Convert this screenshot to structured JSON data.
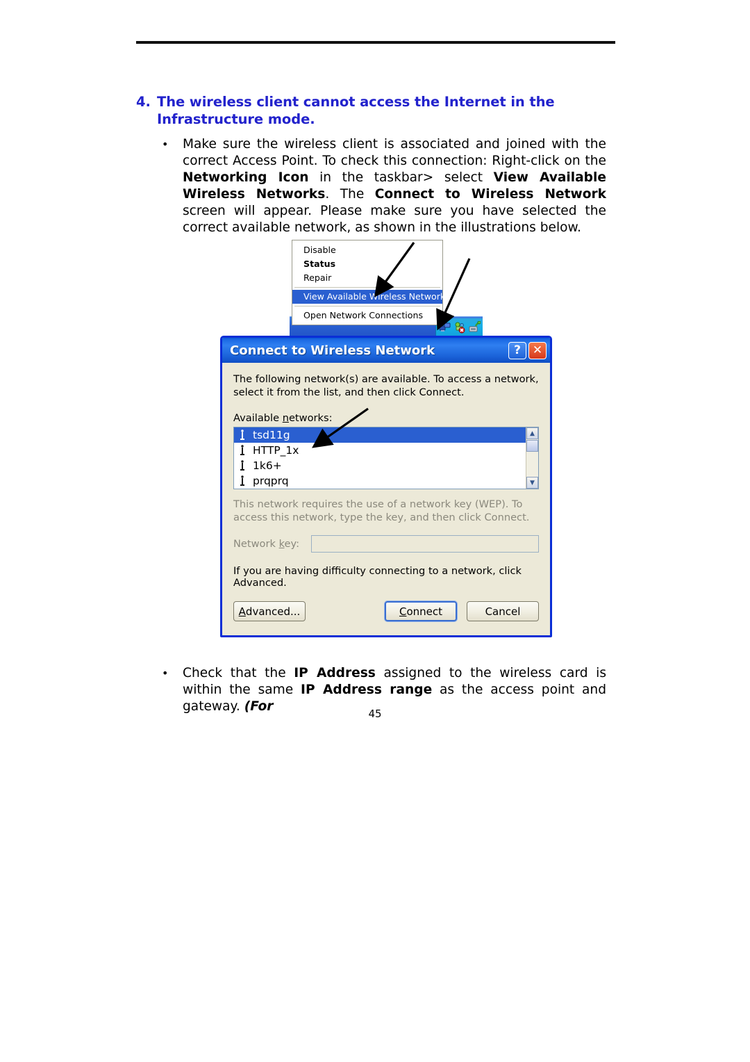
{
  "document": {
    "page_number": "45",
    "heading": {
      "number": "4.",
      "text": "The wireless client cannot access the Internet in the Infrastructure mode.",
      "color": "#2222CC"
    },
    "bullets": [
      {
        "marker": "•",
        "segments": [
          {
            "text": "Make sure the wireless client is associated and joined with the correct Access Point. To check this connection: Right-click on the ",
            "style": "normal"
          },
          {
            "text": "Networking Icon",
            "style": "bold"
          },
          {
            "text": " in the taskbar> select ",
            "style": "normal"
          },
          {
            "text": "View Available Wireless Networks",
            "style": "bold"
          },
          {
            "text": ". The ",
            "style": "normal"
          },
          {
            "text": "Connect to Wireless Network",
            "style": "bold"
          },
          {
            "text": " screen will appear. Please make sure you have selected the correct available network, as shown in the illustrations below.",
            "style": "normal"
          }
        ]
      },
      {
        "marker": "•",
        "segments": [
          {
            "text": "Check that the ",
            "style": "normal"
          },
          {
            "text": "IP Address",
            "style": "bold"
          },
          {
            "text": " assigned to the wireless card is within the same ",
            "style": "normal"
          },
          {
            "text": "IP Address range",
            "style": "bold"
          },
          {
            "text": " as the access point and gateway. ",
            "style": "normal"
          },
          {
            "text": "(For",
            "style": "bolditalic"
          }
        ]
      }
    ]
  },
  "illustration": {
    "context_menu": {
      "items": [
        {
          "label": "Disable",
          "bold": false,
          "selected": false
        },
        {
          "label": "Status",
          "bold": true,
          "selected": false
        },
        {
          "label": "Repair",
          "bold": false,
          "selected": false
        },
        {
          "label": "View Available Wireless Networks",
          "bold": false,
          "selected": true
        },
        {
          "label": "Open Network Connections",
          "bold": false,
          "selected": false
        }
      ],
      "highlight_color": "#2a5fd0"
    },
    "taskbar": {
      "tray_icons": [
        "network-connection-icon",
        "wireless-network-error-icon",
        "network-adapter-icon"
      ]
    },
    "dialog": {
      "title": "Connect to Wireless Network",
      "help_button": "?",
      "close_button": "✕",
      "intro": "The following network(s) are available. To access a network, select it from the list, and then click Connect.",
      "available_label_pre": "Available ",
      "available_label_key": "n",
      "available_label_post": "etworks:",
      "networks": [
        {
          "name": "tsd11g",
          "selected": true
        },
        {
          "name": "HTTP_1x",
          "selected": false
        },
        {
          "name": "1k6+",
          "selected": false
        },
        {
          "name": "prqprq",
          "selected": false
        }
      ],
      "scrollbar": {
        "up_arrow": "▲",
        "down_arrow": "▼"
      },
      "wep_notice": "This network requires the use of a network key (WEP). To access this network, type the key, and then click Connect.",
      "network_key_label_pre": "Network ",
      "network_key_label_key": "k",
      "network_key_label_post": "ey:",
      "network_key_value": "",
      "advice": "If you are having difficulty connecting to a network, click Advanced.",
      "buttons": {
        "advanced_pre": "A",
        "advanced_post": "dvanced...",
        "connect_pre": "C",
        "connect_post": "onnect",
        "cancel": "Cancel"
      },
      "title_bar_color": "#1c6ae4",
      "face_color": "#ece9d8",
      "border_color": "#0a2ed6"
    }
  }
}
